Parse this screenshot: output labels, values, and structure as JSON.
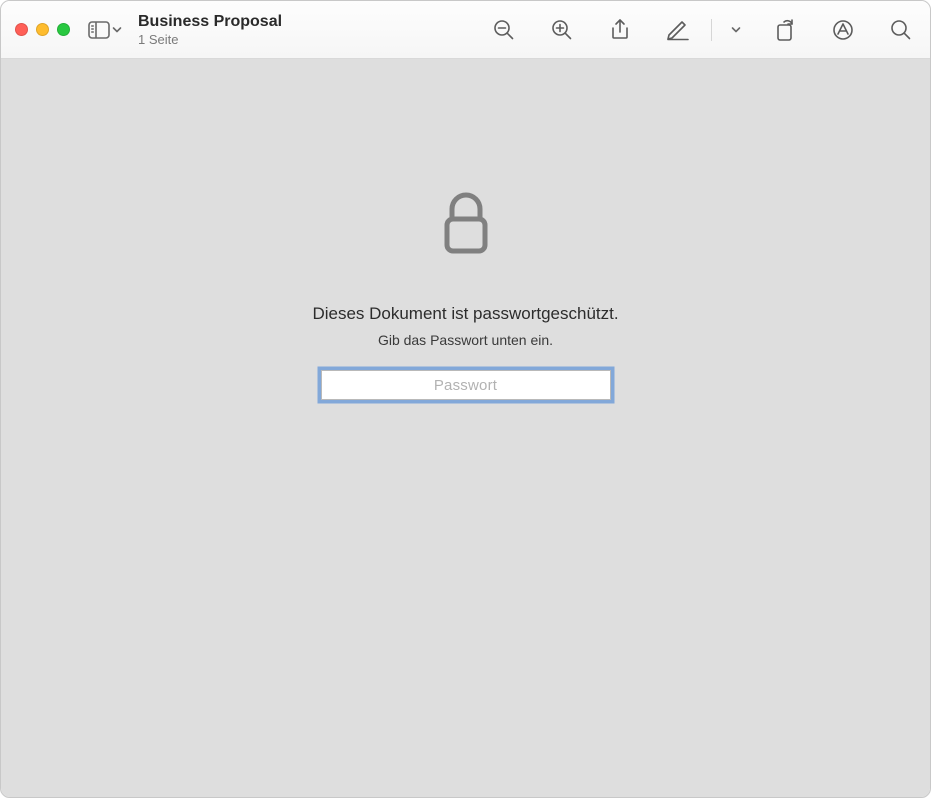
{
  "window": {
    "title": "Business Proposal",
    "subtitle": "1 Seite"
  },
  "prompt": {
    "headline": "Dieses Dokument ist passwortgeschützt.",
    "subhead": "Gib das Passwort unten ein.",
    "placeholder": "Passwort",
    "value": ""
  },
  "icons": {
    "sidebar": "sidebar-icon",
    "chevron_down": "chevron-down-icon",
    "zoom_out": "zoom-out-icon",
    "zoom_in": "zoom-in-icon",
    "share": "share-icon",
    "highlight": "highlight-icon",
    "highlight_menu": "highlight-menu-icon",
    "rotate": "rotate-icon",
    "markup": "markup-icon",
    "search": "search-icon"
  },
  "colors": {
    "content_bg": "#dedede",
    "focus_ring": "#367cd5"
  }
}
